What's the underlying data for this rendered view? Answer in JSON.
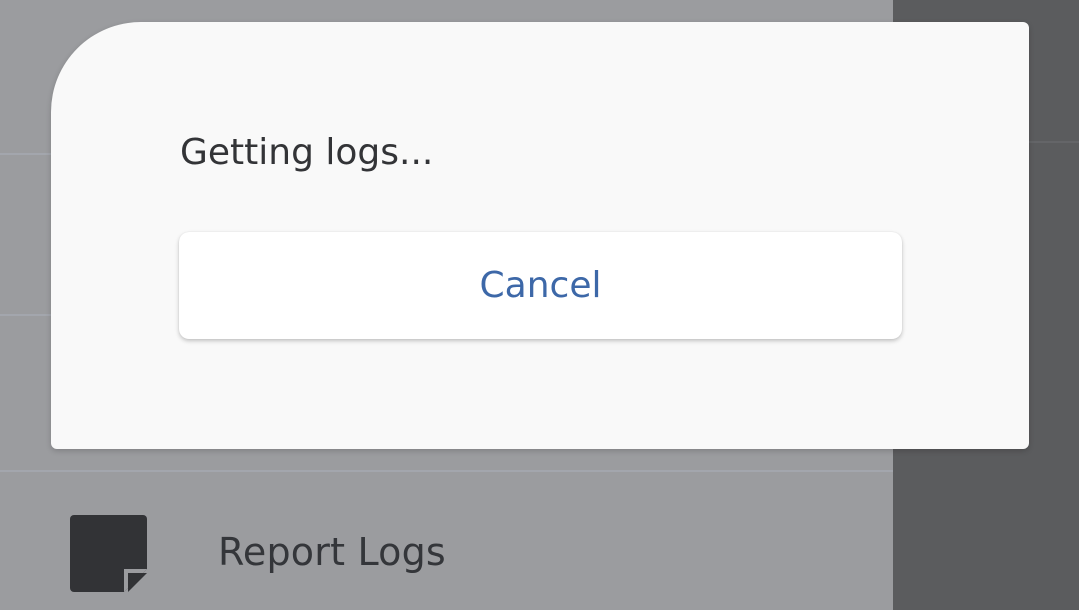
{
  "dialog": {
    "message": "Getting logs...",
    "cancel_label": "Cancel",
    "accent_color": "#3d68a8"
  },
  "drawer": {
    "items": [
      {
        "label": "Report Logs",
        "icon": "sticky-note-icon"
      }
    ]
  }
}
